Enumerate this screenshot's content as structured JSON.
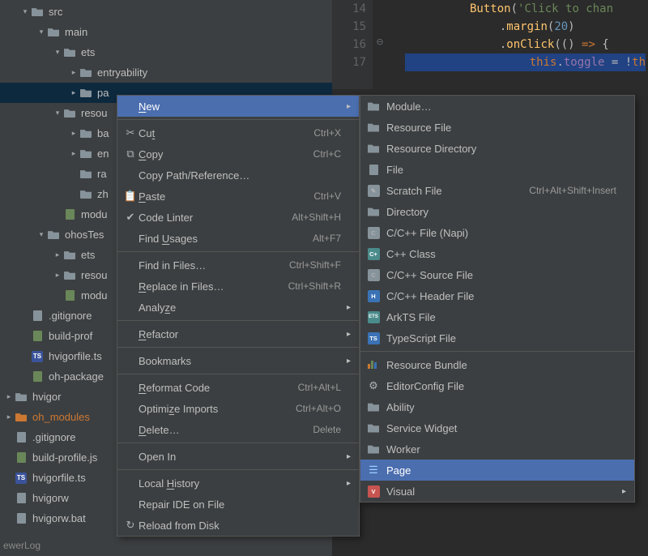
{
  "tree": {
    "rows": [
      {
        "indent": 0,
        "arrow": "down",
        "icon": "folder",
        "label": "src"
      },
      {
        "indent": 1,
        "arrow": "down",
        "icon": "folder",
        "label": "main"
      },
      {
        "indent": 2,
        "arrow": "down",
        "icon": "folder",
        "label": "ets"
      },
      {
        "indent": 3,
        "arrow": "right",
        "icon": "folder",
        "label": "entryability"
      },
      {
        "indent": 3,
        "arrow": "right",
        "icon": "folder",
        "label": "pa",
        "selected": true
      },
      {
        "indent": 2,
        "arrow": "down",
        "icon": "folder",
        "label": "resou"
      },
      {
        "indent": 3,
        "arrow": "right",
        "icon": "folder",
        "label": "ba"
      },
      {
        "indent": 3,
        "arrow": "right",
        "icon": "folder",
        "label": "en"
      },
      {
        "indent": 3,
        "arrow": "blank",
        "icon": "folder",
        "label": "ra"
      },
      {
        "indent": 3,
        "arrow": "blank",
        "icon": "folder",
        "label": "zh"
      },
      {
        "indent": 2,
        "arrow": "blank",
        "icon": "json",
        "label": "modu"
      },
      {
        "indent": 1,
        "arrow": "down",
        "icon": "folder",
        "label": "ohosTes"
      },
      {
        "indent": 2,
        "arrow": "right",
        "icon": "folder",
        "label": "ets"
      },
      {
        "indent": 2,
        "arrow": "right",
        "icon": "folder",
        "label": "resou"
      },
      {
        "indent": 2,
        "arrow": "blank",
        "icon": "json",
        "label": "modu"
      },
      {
        "indent": 0,
        "arrow": "blank",
        "icon": "file",
        "label": ".gitignore"
      },
      {
        "indent": 0,
        "arrow": "blank",
        "icon": "json",
        "label": "build-prof"
      },
      {
        "indent": 0,
        "arrow": "blank",
        "icon": "ts",
        "label": "hvigorfile.ts"
      },
      {
        "indent": 0,
        "arrow": "blank",
        "icon": "json",
        "label": "oh-package"
      },
      {
        "indent": -1,
        "arrow": "right",
        "icon": "folder",
        "label": "hvigor"
      },
      {
        "indent": -1,
        "arrow": "right",
        "icon": "folder-orange",
        "label": "oh_modules",
        "hl": "orange"
      },
      {
        "indent": -1,
        "arrow": "blank",
        "icon": "file",
        "label": ".gitignore"
      },
      {
        "indent": -1,
        "arrow": "blank",
        "icon": "json",
        "label": "build-profile.js"
      },
      {
        "indent": -1,
        "arrow": "blank",
        "icon": "ts",
        "label": "hvigorfile.ts"
      },
      {
        "indent": -1,
        "arrow": "blank",
        "icon": "file",
        "label": "hvigorw"
      },
      {
        "indent": -1,
        "arrow": "blank",
        "icon": "file",
        "label": "hvigorw.bat"
      }
    ],
    "bottomLabel": "ewerLog"
  },
  "editor": {
    "gutter": [
      "14",
      "15",
      "16",
      "17"
    ],
    "lines": [
      [
        {
          "cls": "c-fn",
          "t": "Button"
        },
        {
          "cls": "c-punc",
          "t": "("
        },
        {
          "cls": "c-str",
          "t": "'Click to chan"
        }
      ],
      [
        {
          "cls": "c-punc",
          "t": "  ."
        },
        {
          "cls": "c-fn",
          "t": "margin"
        },
        {
          "cls": "c-punc",
          "t": "("
        },
        {
          "cls": "c-num",
          "t": "20"
        },
        {
          "cls": "c-punc",
          "t": ")"
        }
      ],
      [
        {
          "cls": "c-punc",
          "t": "  ."
        },
        {
          "cls": "c-fn",
          "t": "onClick"
        },
        {
          "cls": "c-punc",
          "t": "(() "
        },
        {
          "cls": "c-kw",
          "t": "=>"
        },
        {
          "cls": "c-punc",
          "t": " {"
        }
      ],
      [
        {
          "cls": "c-punc",
          "t": "    "
        },
        {
          "cls": "c-kw",
          "t": "this"
        },
        {
          "cls": "c-punc",
          "t": "."
        },
        {
          "cls": "c-ident",
          "t": "toggle"
        },
        {
          "cls": "c-punc",
          "t": " = !"
        },
        {
          "cls": "c-kw",
          "t": "th"
        }
      ]
    ]
  },
  "menu1": [
    {
      "type": "row",
      "icon": "",
      "label": "New",
      "mn": "N",
      "sub": true,
      "sel": true
    },
    {
      "type": "sep"
    },
    {
      "type": "row",
      "icon": "✂",
      "label": "Cut",
      "mn": "t",
      "shortcut": "Ctrl+X"
    },
    {
      "type": "row",
      "icon": "⧉",
      "label": "Copy",
      "mn": "C",
      "shortcut": "Ctrl+C"
    },
    {
      "type": "row",
      "icon": "",
      "label": "Copy Path/Reference…"
    },
    {
      "type": "row",
      "icon": "📋",
      "label": "Paste",
      "mn": "P",
      "shortcut": "Ctrl+V"
    },
    {
      "type": "row",
      "icon": "✔",
      "label": "Code Linter",
      "shortcut": "Alt+Shift+H"
    },
    {
      "type": "row",
      "icon": "",
      "label": "Find Usages",
      "mn": "U",
      "shortcut": "Alt+F7"
    },
    {
      "type": "sep"
    },
    {
      "type": "row",
      "icon": "",
      "label": "Find in Files…",
      "shortcut": "Ctrl+Shift+F"
    },
    {
      "type": "row",
      "icon": "",
      "label": "Replace in Files…",
      "mn": "R",
      "shortcut": "Ctrl+Shift+R"
    },
    {
      "type": "row",
      "icon": "",
      "label": "Analyze",
      "mn": "z",
      "sub": true
    },
    {
      "type": "sep"
    },
    {
      "type": "row",
      "icon": "",
      "label": "Refactor",
      "mn": "R",
      "sub": true
    },
    {
      "type": "sep"
    },
    {
      "type": "row",
      "icon": "",
      "label": "Bookmarks",
      "sub": true
    },
    {
      "type": "sep"
    },
    {
      "type": "row",
      "icon": "",
      "label": "Reformat Code",
      "mn": "R",
      "shortcut": "Ctrl+Alt+L"
    },
    {
      "type": "row",
      "icon": "",
      "label": "Optimize Imports",
      "mn": "z",
      "shortcut": "Ctrl+Alt+O"
    },
    {
      "type": "row",
      "icon": "",
      "label": "Delete…",
      "mn": "D",
      "shortcut": "Delete"
    },
    {
      "type": "sep"
    },
    {
      "type": "row",
      "icon": "",
      "label": "Open In",
      "sub": true
    },
    {
      "type": "sep"
    },
    {
      "type": "row",
      "icon": "",
      "label": "Local History",
      "mn": "H",
      "sub": true
    },
    {
      "type": "row",
      "icon": "",
      "label": "Repair IDE on File"
    },
    {
      "type": "row",
      "icon": "↻",
      "label": "Reload from Disk"
    }
  ],
  "menu2": [
    {
      "icon": "folder",
      "label": "Module…"
    },
    {
      "icon": "folder",
      "label": "Resource File"
    },
    {
      "icon": "folder",
      "label": "Resource Directory"
    },
    {
      "icon": "file",
      "label": "File"
    },
    {
      "icon": "scratch",
      "label": "Scratch File",
      "shortcut": "Ctrl+Alt+Shift+Insert"
    },
    {
      "icon": "folder",
      "label": "Directory"
    },
    {
      "icon": "c",
      "label": "C/C++ File (Napi)"
    },
    {
      "icon": "cpp",
      "label": "C++ Class"
    },
    {
      "icon": "c",
      "label": "C/C++ Source File"
    },
    {
      "icon": "h",
      "label": "C/C++ Header File"
    },
    {
      "icon": "ets",
      "label": "ArkTS File"
    },
    {
      "icon": "ts",
      "label": "TypeScript File"
    },
    {
      "sep": true
    },
    {
      "icon": "bundle",
      "label": "Resource Bundle"
    },
    {
      "icon": "gear",
      "label": "EditorConfig File"
    },
    {
      "icon": "folder",
      "label": "Ability"
    },
    {
      "icon": "folder",
      "label": "Service Widget"
    },
    {
      "icon": "folder",
      "label": "Worker"
    },
    {
      "icon": "list",
      "label": "Page",
      "sel": true
    },
    {
      "icon": "v",
      "label": "Visual",
      "sub": true
    }
  ]
}
